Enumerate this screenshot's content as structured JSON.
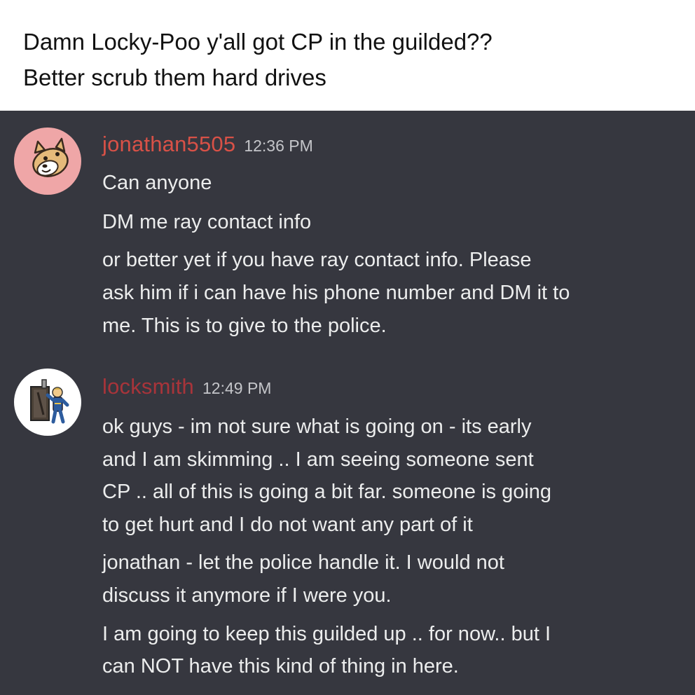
{
  "caption": {
    "line1": "Damn Locky-Poo y'all got CP in the guilded??",
    "line2": "Better scrub them hard drives"
  },
  "messages": [
    {
      "username": "jonathan5505",
      "timestamp": "12:36 PM",
      "avatar_icon": "dog-face-icon",
      "lines": [
        "Can anyone",
        "DM me ray contact info",
        "or better yet if you have ray contact info.  Please",
        "ask him if i can have his phone number and DM it to",
        "me.  This is to give to the police."
      ]
    },
    {
      "username": "locksmith",
      "timestamp": "12:49 PM",
      "avatar_icon": "vault-boy-locksmith-icon",
      "lines": [
        "ok guys - im not sure what is going on - its early",
        "and I am skimming .. I am seeing someone sent",
        "CP .. all of this is going a bit far. someone is going",
        "to get hurt and I do not want any part of it",
        "jonathan - let the police handle it. I would not",
        "discuss it anymore if I were you.",
        "I am going to keep this guilded up .. for now.. but I",
        "can NOT have this kind of thing in here."
      ]
    }
  ],
  "colors": {
    "chat_background": "#36373f",
    "username": "#d85147",
    "timestamp": "#c4c5c9",
    "message_text": "#eceded",
    "avatar1_background": "#efa6a7"
  }
}
